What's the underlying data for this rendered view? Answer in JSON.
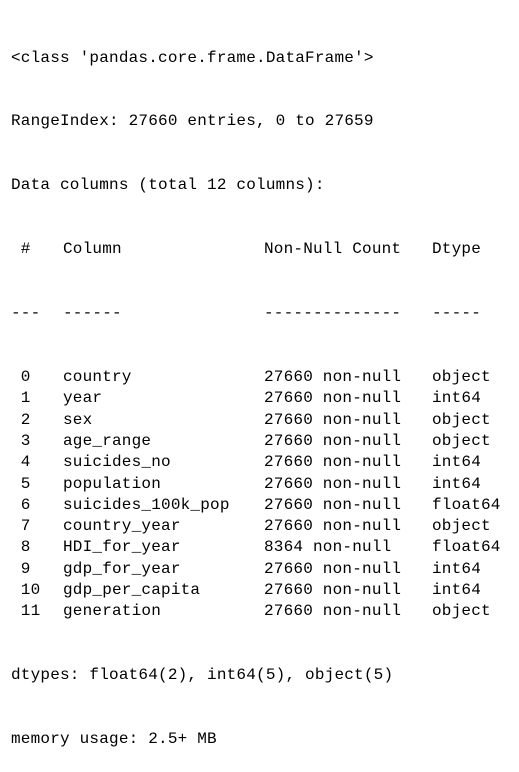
{
  "output": {
    "class_line": "<class 'pandas.core.frame.DataFrame'>",
    "range_index": "RangeIndex: 27660 entries, 0 to 27659",
    "data_columns": "Data columns (total 12 columns):",
    "headers": {
      "num": " #",
      "column": "Column",
      "count": "Non-Null Count",
      "dtype": "Dtype"
    },
    "separators": {
      "num": "---",
      "column": "------",
      "count": "--------------",
      "dtype": "-----"
    },
    "rows": [
      {
        "num": " 0",
        "column": "country",
        "count": "27660 non-null",
        "dtype": "object"
      },
      {
        "num": " 1",
        "column": "year",
        "count": "27660 non-null",
        "dtype": "int64"
      },
      {
        "num": " 2",
        "column": "sex",
        "count": "27660 non-null",
        "dtype": "object"
      },
      {
        "num": " 3",
        "column": "age_range",
        "count": "27660 non-null",
        "dtype": "object"
      },
      {
        "num": " 4",
        "column": "suicides_no",
        "count": "27660 non-null",
        "dtype": "int64"
      },
      {
        "num": " 5",
        "column": "population",
        "count": "27660 non-null",
        "dtype": "int64"
      },
      {
        "num": " 6",
        "column": "suicides_100k_pop",
        "count": "27660 non-null",
        "dtype": "float64"
      },
      {
        "num": " 7",
        "column": "country_year",
        "count": "27660 non-null",
        "dtype": "object"
      },
      {
        "num": " 8",
        "column": "HDI_for_year",
        "count": "8364 non-null",
        "dtype": "float64"
      },
      {
        "num": " 9",
        "column": "gdp_for_year",
        "count": "27660 non-null",
        "dtype": "int64"
      },
      {
        "num": " 10",
        "column": "gdp_per_capita",
        "count": "27660 non-null",
        "dtype": "int64"
      },
      {
        "num": " 11",
        "column": "generation",
        "count": "27660 non-null",
        "dtype": "object"
      }
    ],
    "dtypes_line": "dtypes: float64(2), int64(5), object(5)",
    "memory_line": "memory usage: 2.5+ MB"
  }
}
